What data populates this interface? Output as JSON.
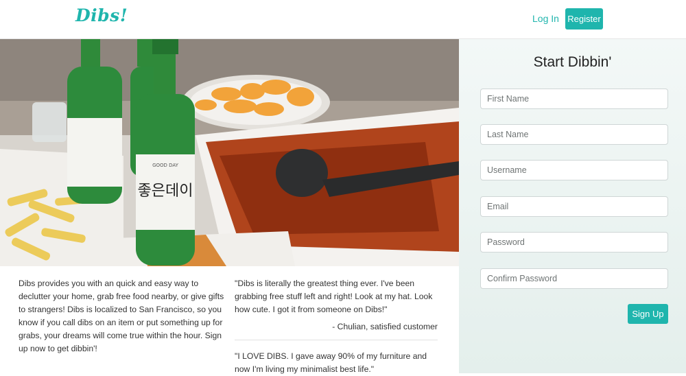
{
  "nav": {
    "logo": "Dibs!",
    "login": "Log In",
    "register": "Register"
  },
  "about": {
    "text": "Dibs provides you with an quick and easy way to declutter your home, grab free food nearby, or give gifts to strangers! Dibs is localized to San Francisco, so you know if you call dibs on an item or put something up for grabs, your dreams will come true within the hour. Sign up now to get dibbin'!"
  },
  "testimonials": [
    {
      "quote": "\"Dibs is literally the greatest thing ever. I've been grabbing free stuff left and right! Look at my hat. Look how cute. I got it from someone on Dibs!\"",
      "author": "- Chulian, satisfied customer"
    },
    {
      "quote": "\"I LOVE DIBS. I gave away 90% of my furniture and now I'm living my minimalist best life.\"",
      "author": ""
    }
  ],
  "signup": {
    "title": "Start Dibbin'",
    "fields": {
      "first_name": "First Name",
      "last_name": "Last Name",
      "username": "Username",
      "email": "Email",
      "password": "Password",
      "confirm_password": "Confirm Password"
    },
    "button": "Sign Up"
  },
  "hero": {
    "bottle_label": "좋은데이",
    "bottle_brand": "GOOD DAY"
  },
  "colors": {
    "accent": "#1fb5ad",
    "panel": "#e9f2f0"
  }
}
